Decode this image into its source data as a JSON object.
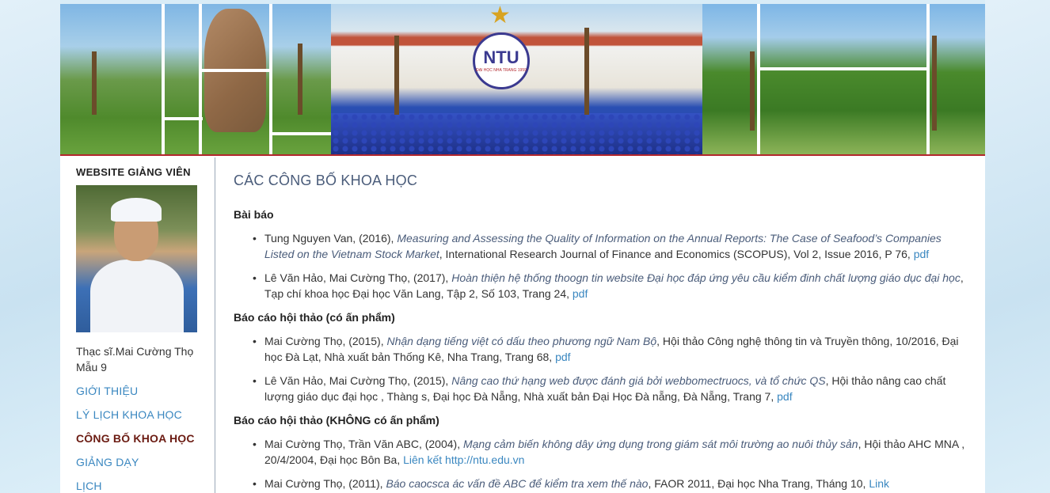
{
  "sidebar": {
    "heading": "WEBSITE GIẢNG VIÊN",
    "name": "Thạc sĩ.Mai Cường Thọ Mẫu 9",
    "nav": [
      {
        "label": "GIỚI THIỆU",
        "active": false
      },
      {
        "label": "LÝ LỊCH KHOA HỌC",
        "active": false
      },
      {
        "label": "CÔNG BỐ KHOA HỌC",
        "active": true
      },
      {
        "label": "GIẢNG DẠY",
        "active": false
      },
      {
        "label": "LỊCH",
        "active": false
      }
    ]
  },
  "banner": {
    "logo_mark": "NTU",
    "logo_sub": "ĐẠI HỌC NHA TRANG 1959"
  },
  "main": {
    "title": "CÁC CÔNG BỐ KHOA HỌC",
    "sections": [
      {
        "heading": "Bài báo",
        "items": [
          {
            "authors": "Tung Nguyen Van, (2016), ",
            "title": "Measuring and Assessing the Quality of Information on the Annual Reports: The Case of Seafood’s Companies Listed on the Vietnam Stock Market",
            "rest": ", International Research Journal of Finance and Economics (SCOPUS), Vol 2, Issue 2016, P 76, ",
            "link": "pdf"
          },
          {
            "authors": "Lê Văn Hảo, Mai Cường Thọ, (2017), ",
            "title": "Hoàn thiện hệ thống thoogn tin website Đại học đáp ứng yêu cầu kiểm đinh chất lượng giáo dục đại học",
            "rest": ", Tạp chí khoa học Đại học Văn Lang, Tập 2, Số 103, Trang 24, ",
            "link": "pdf"
          }
        ]
      },
      {
        "heading": "Báo cáo hội thảo (có ấn phẩm)",
        "items": [
          {
            "authors": "Mai Cường Thọ, (2015), ",
            "title": "Nhận dạng tiếng việt có dấu theo phương ngữ Nam Bộ",
            "rest": ", Hội thảo Công nghệ thông tin và Truyền thông, 10/2016, Đại học Đà Lạt, Nhà xuất bản Thống Kê, Nha Trang, Trang 68, ",
            "link": "pdf"
          },
          {
            "authors": "Lê Văn Hảo, Mai Cường Thọ, (2015), ",
            "title": "Nâng cao thứ hạng web được đánh giá bởi webbomectruocs, và tổ chức QS",
            "rest": ", Hội thảo nâng cao chất lượng giáo dục đại học , Thàng s, Đại học Đà Nẵng, Nhà xuất bản Đại Học Đà nẵng, Đà Nẵng, Trang 7, ",
            "link": "pdf"
          }
        ]
      },
      {
        "heading": "Báo cáo hội thảo (KHÔNG có ấn phẩm)",
        "items": [
          {
            "authors": "Mai Cường Thọ, Trần Văn ABC, (2004), ",
            "title": "Mạng cảm biến không dây ứng dụng trong giám sát môi trường ao nuôi thủy sản",
            "rest": ", Hội thảo AHC MNA , 20/4/2004, Đại học Bôn Ba, ",
            "link": "Liên kết http://ntu.edu.vn"
          },
          {
            "authors": "Mai Cường Thọ, (2011), ",
            "title": "Báo caocsca ác vấn đề ABC để kiểm tra xem thế nào",
            "rest": ", FAOR 2011, Đại học Nha Trang, Tháng 10, ",
            "link": "Link"
          }
        ]
      }
    ]
  }
}
